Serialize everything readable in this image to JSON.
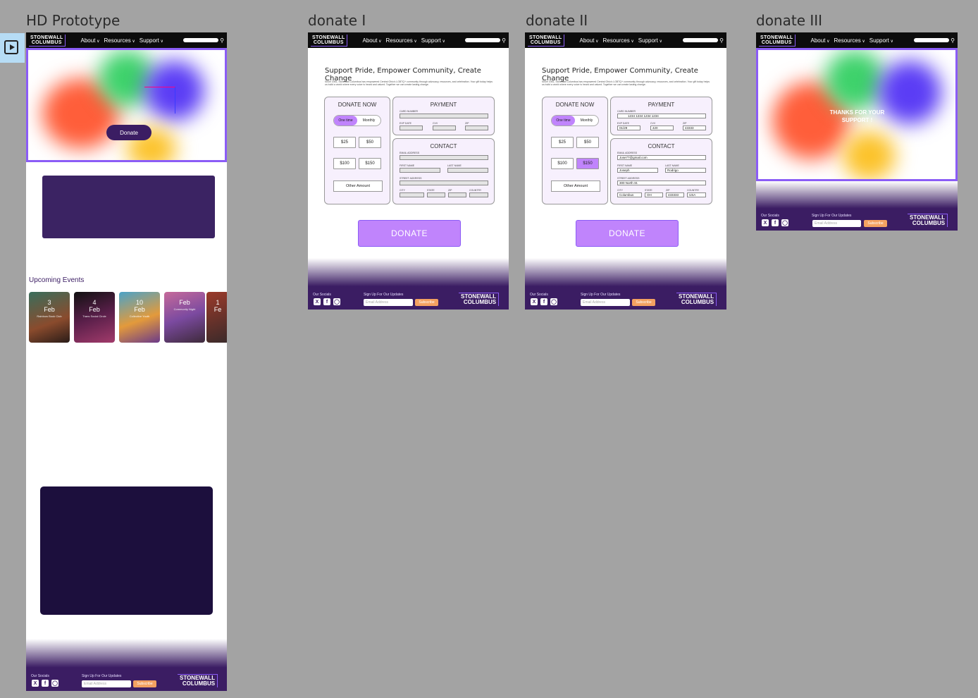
{
  "frames": {
    "hd": {
      "title": "HD Prototype"
    },
    "d1": {
      "title": "donate I"
    },
    "d2": {
      "title": "donate II"
    },
    "d3": {
      "title": "donate III"
    }
  },
  "nav": {
    "logo_line1": "STONEWALL",
    "logo_line2": "COLUMBUS",
    "about": "About",
    "resources": "Resources",
    "support": "Support"
  },
  "hd": {
    "donate_button": "Donate",
    "events_heading": "Upcoming Events",
    "events": [
      {
        "day": "3",
        "month": "Feb",
        "sub": "Rainbow Book Club"
      },
      {
        "day": "4",
        "month": "Feb",
        "sub": "Trans Social Circle"
      },
      {
        "day": "10",
        "month": "Feb",
        "sub": "Collective Youth"
      },
      {
        "day": "",
        "month": "Feb",
        "sub": "Community Night"
      },
      {
        "day": "1",
        "month": "Fe",
        "sub": ""
      }
    ]
  },
  "donate": {
    "heading": "Support Pride, Empower Community, Create Change",
    "intro": "Since 1981, Stonewall Columbus has empowered Central Ohio's LGBTQ+ community through advocacy, resources, and celebration. Your gift today helps us build a world where every voice is heard and valued. Together we can create lasting change.",
    "donate_now": "DONATE NOW",
    "one_time": "One time",
    "monthly": "Monthly",
    "amounts": [
      "$25",
      "$50",
      "$100",
      "$150"
    ],
    "other_amount": "Other Amount",
    "payment": "PAYMENT",
    "contact": "CONTACT",
    "card_number_label": "CARD NUMBER",
    "exp_label": "EXP DATE",
    "cvv_label": "CVV",
    "zip_label": "ZIP",
    "email_label": "EMAIL ADDRESS",
    "first_label": "FIRST NAME",
    "last_label": "LAST NAME",
    "street_label": "STREET ADDRESS",
    "city_label": "CITY",
    "state_label": "STATE",
    "country_label": "COUNTRY",
    "donate_button": "DONATE"
  },
  "donate_filled": {
    "card": "1234 1234 1234 1234",
    "exp": "01/29",
    "cvv": "420",
    "zip": "43333",
    "email": "Jose77@gmail.com",
    "first": "Joseph",
    "last": "Rodrigo",
    "street": "300 North St.",
    "city": "Columbus",
    "state": "OH",
    "zip2": "433333",
    "country": "USA"
  },
  "thanks": {
    "message": "THANKS FOR YOUR SUPPORT !"
  },
  "footer": {
    "socials_label": "Our Socials",
    "signup_label": "Sign Up For Our Updates",
    "email_placeholder": "Email Address",
    "subscribe": "Subscribe",
    "logo_line1": "STONEWALL",
    "logo_line2": "COLUMBUS"
  },
  "colors": {
    "accent": "#8b5cf6",
    "button": "#c084fc",
    "dark_purple": "#3b1d63",
    "subscribe": "#f4a261"
  }
}
